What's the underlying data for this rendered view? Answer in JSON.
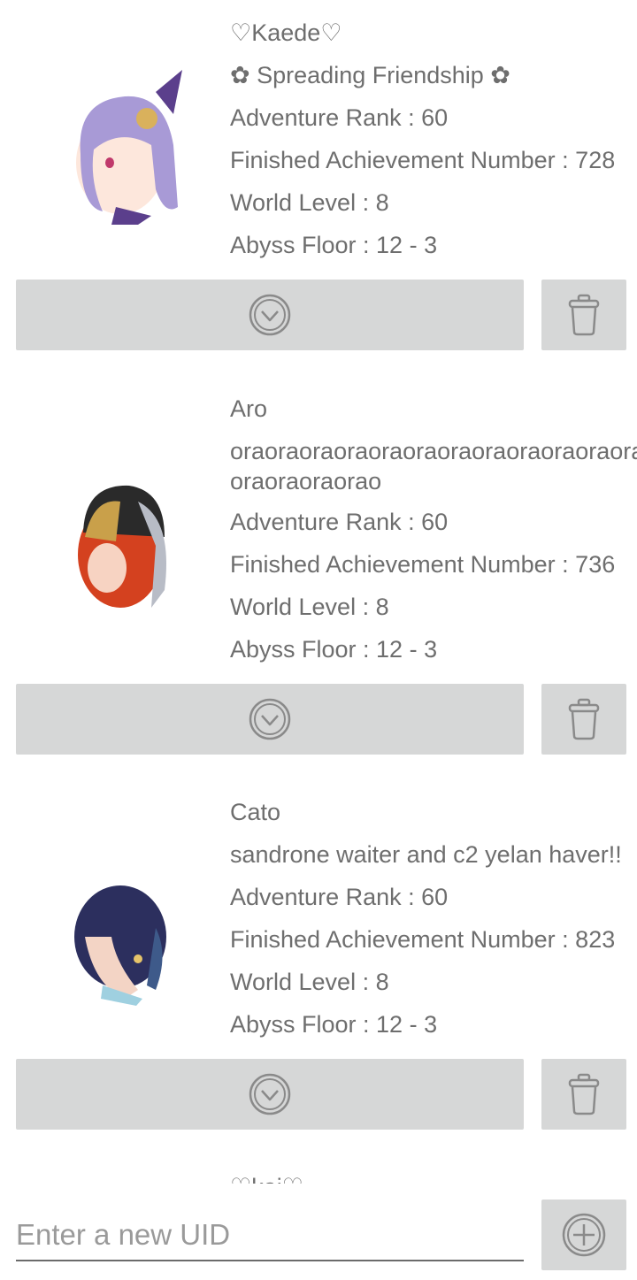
{
  "accounts": [
    {
      "name": "♡Kaede♡",
      "signature": "✿ Spreading Friendship ✿",
      "adventure_rank": "Adventure Rank : 60",
      "achievements": "Finished Achievement Number : 728",
      "world_level": "World Level : 8",
      "abyss_floor": "Abyss Floor : 12 - 3",
      "avatar_hair": "#a89ad6",
      "avatar_accent": "#5b3f8c"
    },
    {
      "name": "Aro",
      "signature": "oraoraoraoraoraoraoraoraoraoraoraoraoraoraoraorao",
      "adventure_rank": "Adventure Rank : 60",
      "achievements": "Finished Achievement Number : 736",
      "world_level": "World Level : 8",
      "abyss_floor": "Abyss Floor : 12 - 3",
      "avatar_hair": "#d4411f",
      "avatar_accent": "#c9a04a"
    },
    {
      "name": "Cato",
      "signature": "sandrone waiter and c2 yelan haver!!",
      "adventure_rank": "Adventure Rank : 60",
      "achievements": "Finished Achievement Number : 823",
      "world_level": "World Level : 8",
      "abyss_floor": "Abyss Floor : 12 - 3",
      "avatar_hair": "#2c2f5e",
      "avatar_accent": "#3e5a8a"
    },
    {
      "name": "♡kai♡"
    }
  ],
  "new_uid": {
    "placeholder": "Enter a new UID",
    "value": ""
  },
  "icons": {
    "expand": "chevron-down-circle-icon",
    "delete": "trash-icon",
    "add": "plus-circle-icon"
  },
  "colors": {
    "button_bg": "#d6d7d7",
    "text": "#6e6e6e",
    "icon": "#8a8a8a"
  }
}
